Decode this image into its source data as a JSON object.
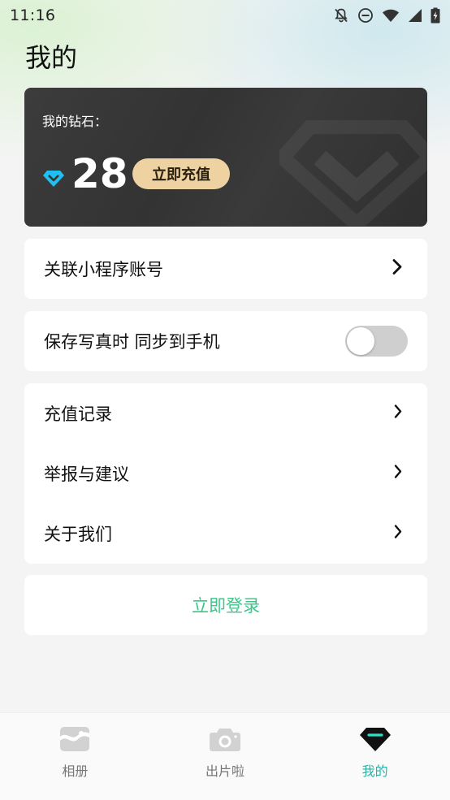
{
  "status_bar": {
    "time": "11:16",
    "icons": [
      "bell-off-icon",
      "do-not-disturb-icon",
      "wifi-icon",
      "signal-icon",
      "battery-charging-icon"
    ]
  },
  "page": {
    "title": "我的"
  },
  "diamond_card": {
    "label": "我的钻石：",
    "count": "28",
    "recharge_label": "立即充值",
    "gem_color": "#1fc0f0",
    "button_color": "#efd2a2"
  },
  "link_panel": {
    "label": "关联小程序账号"
  },
  "sync_panel": {
    "label": "保存写真时 同步到手机",
    "toggle_on": false
  },
  "menu_panel": {
    "items": [
      {
        "label": "充值记录"
      },
      {
        "label": "举报与建议"
      },
      {
        "label": "关于我们"
      }
    ]
  },
  "login_panel": {
    "label": "立即登录",
    "color": "#3cc68a"
  },
  "bottom_nav": {
    "items": [
      {
        "label": "相册",
        "icon": "album-icon",
        "active": false
      },
      {
        "label": "出片啦",
        "icon": "camera-icon",
        "active": false
      },
      {
        "label": "我的",
        "icon": "diamond-icon",
        "active": true
      }
    ],
    "active_color": "#1fb5a8"
  }
}
